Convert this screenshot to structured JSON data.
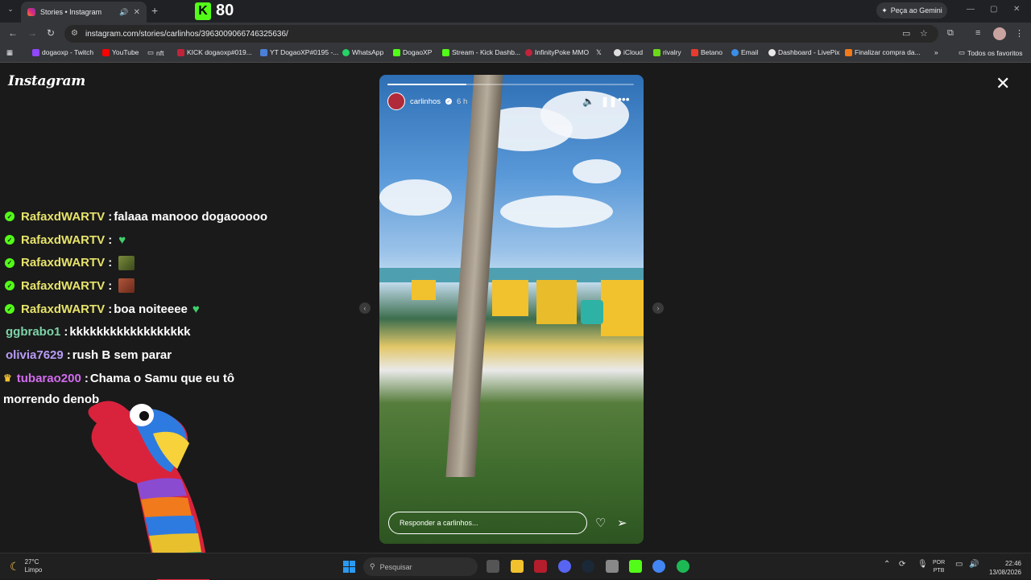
{
  "browser": {
    "tab_title": "Stories • Instagram",
    "kick_count": "80",
    "gemini_label": "Peça ao Gemini",
    "url": "instagram.com/stories/carlinhos/3963009066746325636/",
    "bookmarks": [
      "dogaoxp - Twitch",
      "YouTube",
      "nft",
      "KICK dogaoxp#019...",
      "YT DogaoXP#0195 -...",
      "WhatsApp",
      "DogaoXP",
      "Stream - Kick Dashb...",
      "InfinityPoke MMO",
      "iCloud",
      "rivalry",
      "Betano",
      "Email",
      "Dashboard - LivePix",
      "Finalizar compra da...",
      "Todos os favoritos"
    ]
  },
  "page": {
    "logo": "Instagram",
    "story": {
      "username": "carlinhos",
      "time": "6 h",
      "progress": 0.32,
      "reply_placeholder": "Responder a carlinhos..."
    }
  },
  "chat": [
    {
      "user": "RafaxdWARTV",
      "text": "falaaa manooo dogaooooo",
      "user_color": "#e7e36b",
      "badge": "check"
    },
    {
      "user": "RafaxdWARTV",
      "text": "",
      "user_color": "#e7e36b",
      "badge": "check",
      "extra": "heart"
    },
    {
      "user": "RafaxdWARTV",
      "text": "",
      "user_color": "#e7e36b",
      "badge": "check",
      "extra": "emote-frog"
    },
    {
      "user": "RafaxdWARTV",
      "text": "",
      "user_color": "#e7e36b",
      "badge": "check",
      "extra": "emote-face"
    },
    {
      "user": "RafaxdWARTV",
      "text": "boa noiteeee",
      "user_color": "#e7e36b",
      "badge": "check",
      "extra": "heart"
    },
    {
      "user": "ggbrabo1",
      "text": "kkkkkkkkkkkkkkkkkk",
      "user_color": "#7dd3a8",
      "badge": ""
    },
    {
      "user": "olivia7629",
      "text": "rush B sem parar",
      "user_color": "#b79cf5",
      "badge": ""
    },
    {
      "user": "tubarao200",
      "text": "Chama o Samu que eu tô",
      "text2": "morrendo denob",
      "user_color": "#d36cf0",
      "badge": "crown"
    }
  ],
  "taskbar": {
    "temp": "27°C",
    "weather": "Limpo",
    "search_placeholder": "Pesquisar",
    "lang1": "POR",
    "lang2": "PTB",
    "time": "22:46",
    "date": "13/08/2026"
  }
}
